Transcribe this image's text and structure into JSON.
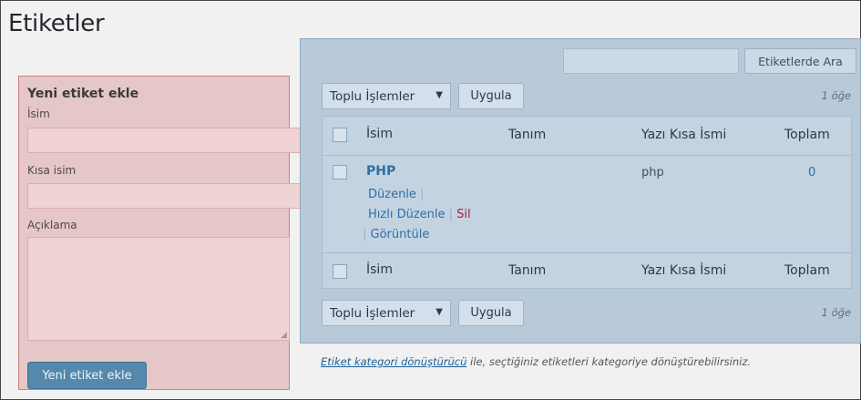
{
  "page": {
    "title": "Etiketler"
  },
  "add_tag": {
    "heading": "Yeni etiket ekle",
    "name_label": "İsim",
    "name_value": "",
    "slug_label": "Kısa isim",
    "slug_value": "",
    "description_label": "Açıklama",
    "description_value": "",
    "submit_label": "Yeni etiket ekle"
  },
  "search": {
    "value": "",
    "button_label": "Etiketlerde Ara"
  },
  "bulk_top": {
    "select_value": "Toplu İşlemler",
    "apply_label": "Uygula",
    "count": "1 öğe"
  },
  "bulk_bottom": {
    "select_value": "Toplu İşlemler",
    "apply_label": "Uygula",
    "count": "1 öğe"
  },
  "table": {
    "columns": {
      "name": "İsim",
      "description": "Tanım",
      "slug": "Yazı Kısa İsmi",
      "count": "Toplam"
    },
    "rows": [
      {
        "name": "PHP",
        "description": "",
        "slug": "php",
        "count": "0",
        "actions": {
          "edit": "Düzenle",
          "quick_edit": "Hızlı Düzenle",
          "delete": "Sil",
          "view": "Görüntüle"
        }
      }
    ]
  },
  "footnote": {
    "link_text": "Etiket kategori dönüştürücü",
    "rest_text": " ile, seçtiğiniz etiketleri kategoriye dönüştürebilirsiniz."
  },
  "icons": {
    "select_arrow": "chevron-down-icon",
    "resize": "resize-grip-icon"
  },
  "colors": {
    "left_panel_bg": "#e6c7c7",
    "right_panel_bg": "#b8c9d9",
    "link": "#2e6fa7",
    "delete_link": "#a1203c",
    "primary_button": "#5488ad"
  }
}
